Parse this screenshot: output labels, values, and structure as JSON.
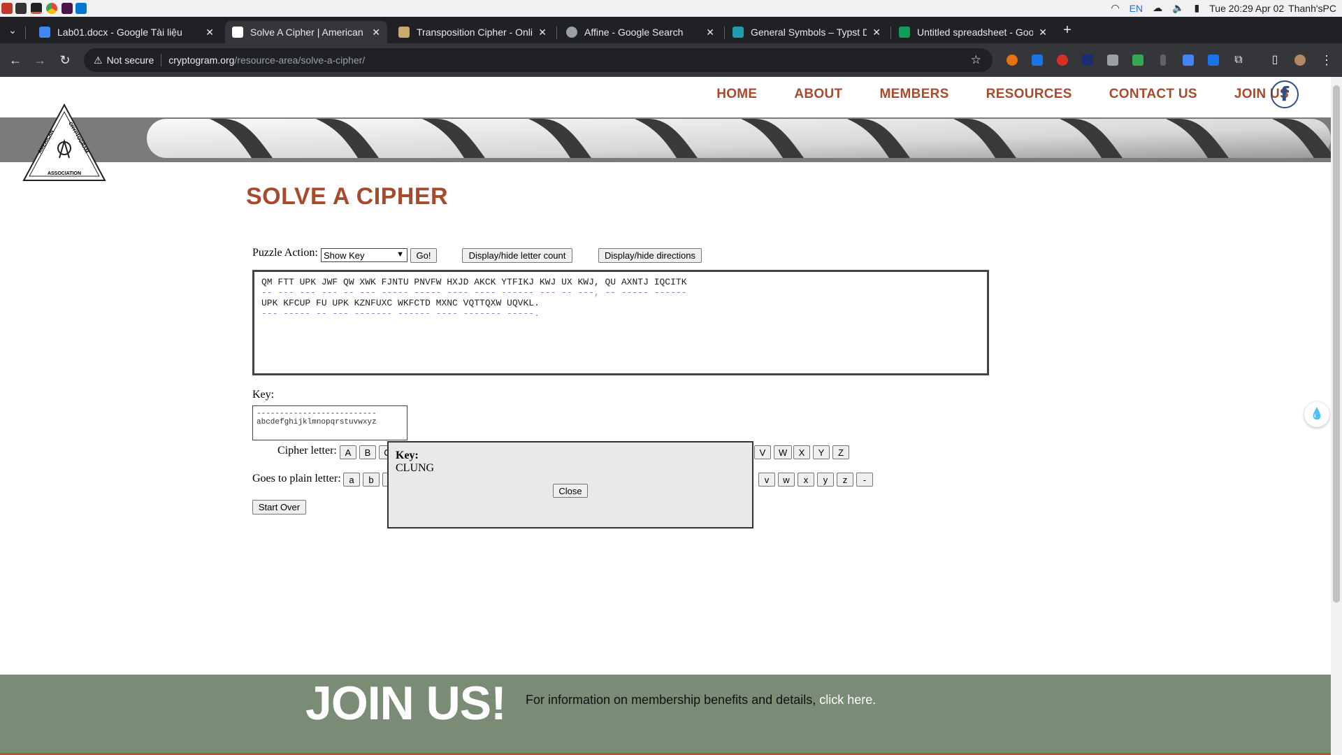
{
  "os": {
    "clock": "Tue 20:29 Apr 02",
    "user": "Thanh'sPC",
    "lang": "EN"
  },
  "tabs": [
    {
      "title": "Lab01.docx - Google Tài liệu",
      "color": "#4285f4"
    },
    {
      "title": "Solve A Cipher | American Cry",
      "color": "#ffffff"
    },
    {
      "title": "Transposition Cipher - Online D",
      "color": "#c9a96e"
    },
    {
      "title": "Affine - Google Search",
      "color": "#9aa0a6"
    },
    {
      "title": "General Symbols – Typst Docu",
      "color": "#239dad"
    },
    {
      "title": "Untitled spreadsheet - Google",
      "color": "#0f9d58"
    }
  ],
  "toolbar": {
    "security": "Not secure",
    "url_host": "cryptogram.org",
    "url_path": "/resource-area/solve-a-cipher/"
  },
  "site_nav": {
    "items": [
      "HOME",
      "ABOUT",
      "MEMBERS",
      "RESOURCES",
      "CONTACT US",
      "JOIN US"
    ],
    "facebook": "f"
  },
  "logo": {
    "top_left": "AMERICAN",
    "top_right": "CRYPTOGRAM",
    "bottom": "ASSOCIATION"
  },
  "page": {
    "title": "SOLVE A CIPHER"
  },
  "controls": {
    "puzzle_action_label": "Puzzle Action:",
    "puzzle_action_value": "Show Key",
    "go_label": "Go!",
    "letter_count_label": "Display/hide letter count",
    "directions_label": "Display/hide directions"
  },
  "puzzle": {
    "line1": "QM FTT UPK JWF QW XWK FJNTU PNVFW HXJD AKCK YTFIKJ KWJ UX KWJ, QU AXNTJ IQCITK",
    "dash1": "-- --- --- --- -- --- ----- ----- ---- ---- ------ --- -- ---, -- ----- ------",
    "line2": "UPK KFCUP FU UPK KZNFUXC WKFCTD MXNC VQTTQXW UQVKL.",
    "dash2": "--- ----- -- --- ------- ------ ---- ------- -----."
  },
  "key": {
    "label": "Key:",
    "dashes": "--------------------------",
    "alphabet": "abcdefghijklmnopqrstuvwxyz"
  },
  "cipher_letter": {
    "label": "Cipher letter:",
    "left_buttons": [
      "A",
      "B",
      "C"
    ],
    "right_buttons": [
      "V",
      "W",
      "X",
      "Y",
      "Z"
    ]
  },
  "plain_letter": {
    "label": "Goes to plain letter:",
    "left_buttons": [
      "a",
      "b",
      "c"
    ],
    "right_buttons": [
      "v",
      "w",
      "x",
      "y",
      "z",
      "-"
    ]
  },
  "start_over_label": "Start Over",
  "modal": {
    "label": "Key:",
    "value": "CLUNG",
    "close_label": "Close"
  },
  "footer": {
    "heading": "JOIN US!",
    "info": "For information on membership benefits and details,",
    "link": "click here."
  },
  "colors": {
    "brand": "#a84a2c",
    "footer": "#7a8c76"
  }
}
